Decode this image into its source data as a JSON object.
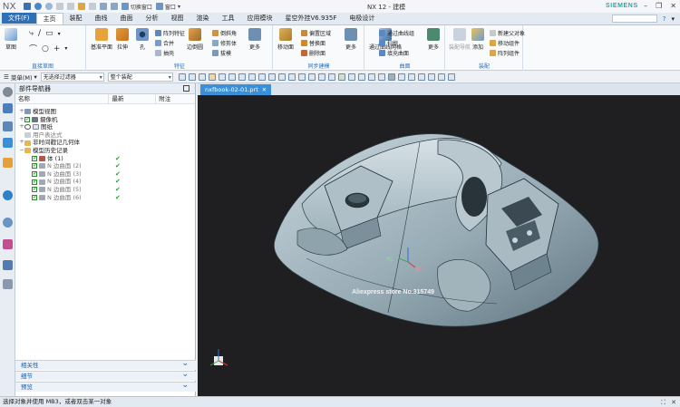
{
  "titlebar": {
    "app_logo": "NX",
    "switch_window": "切换窗口",
    "window": "窗口",
    "window_title": "NX 12 - 建模",
    "brand": "SIEMENS"
  },
  "tabs": [
    "文件(F)",
    "主页",
    "装配",
    "曲线",
    "曲面",
    "分析",
    "视图",
    "渲染",
    "工具",
    "应用模块",
    "星空外挂V6.935F",
    "电极设计"
  ],
  "ribbon": {
    "sketch": "草图",
    "group_direct_sketch": "直接草图",
    "base_plane": "基准平面",
    "extrude": "拉伸",
    "hole": "孔",
    "pattern_feature": "阵列特征",
    "unite": "合并",
    "shell": "抽壳",
    "group_feature": "特征",
    "edge_blend": "边倒圆",
    "chamfer": "倒斜角",
    "trim_body": "修剪体",
    "draft": "拔模",
    "more1": "更多",
    "move_face": "移动面",
    "offset_region": "偏置区域",
    "replace_face": "替换面",
    "delete_face": "删除面",
    "more2": "更多",
    "group_sync_modeling": "同步建模",
    "through_curve_mesh": "通过曲线网格",
    "through_curves": "通过曲线组",
    "sweep": "扫掠",
    "face_blend": "填充曲面",
    "more3": "更多",
    "group_surface": "曲面",
    "assembly_nav": "装配导航",
    "add": "添加",
    "new_parent": "新建父对象",
    "move_component": "移动组件",
    "pattern_component": "阵列组件",
    "group_assembly": "装配"
  },
  "selection": {
    "menu": "菜单(M)",
    "filter": "无选择过滤器",
    "scope": "整个装配"
  },
  "navigator": {
    "title": "部件导航器",
    "col_name": "名称",
    "col_latest": "最新",
    "col_note": "附注",
    "rows": [
      {
        "label": "模型视图",
        "level": 1,
        "expander": "+",
        "kind": "folder"
      },
      {
        "label": "摄像机",
        "level": 1,
        "expander": "+",
        "kind": "camera"
      },
      {
        "label": "图纸",
        "level": 1,
        "expander": "+",
        "kind": "sheet"
      },
      {
        "label": "用户表达式",
        "level": 1,
        "expander": "",
        "kind": "grey-folder"
      },
      {
        "label": "非时间戳记几何体",
        "level": 1,
        "expander": "+",
        "kind": "folder"
      },
      {
        "label": "模型历史记录",
        "level": 1,
        "expander": "−",
        "kind": "folder"
      },
      {
        "label": "体 (1)",
        "level": 2,
        "expander": "",
        "kind": "body",
        "latest": "✔"
      },
      {
        "label": "N 边曲面 (2)",
        "level": 2,
        "expander": "",
        "kind": "surface",
        "latest": "✔"
      },
      {
        "label": "N 边曲面 (3)",
        "level": 2,
        "expander": "",
        "kind": "surface",
        "latest": "✔"
      },
      {
        "label": "N 边曲面 (4)",
        "level": 2,
        "expander": "",
        "kind": "surface",
        "latest": "✔"
      },
      {
        "label": "N 边曲面 (5)",
        "level": 2,
        "expander": "",
        "kind": "surface",
        "latest": "✔"
      },
      {
        "label": "N 边曲面 (6)",
        "level": 2,
        "expander": "",
        "kind": "surface",
        "latest": "✔"
      }
    ],
    "panels": [
      "相关性",
      "细节",
      "预览"
    ]
  },
  "graphics": {
    "tab_label": "nxfbook-02-01.prt",
    "watermark": "Aliexpress store No.315749",
    "axis_xc": "XC",
    "axis_yc": "YC",
    "axis_zc": "ZC"
  },
  "status": {
    "message": "选择对象并使用 MB3，或者双击某一对象"
  },
  "colors": {
    "accent": "#2e6fb6",
    "brand": "#2aa7a7",
    "model": "#9fb0b8",
    "viewport_bg": "#1f1f22",
    "latest_check": "#21a03b"
  }
}
